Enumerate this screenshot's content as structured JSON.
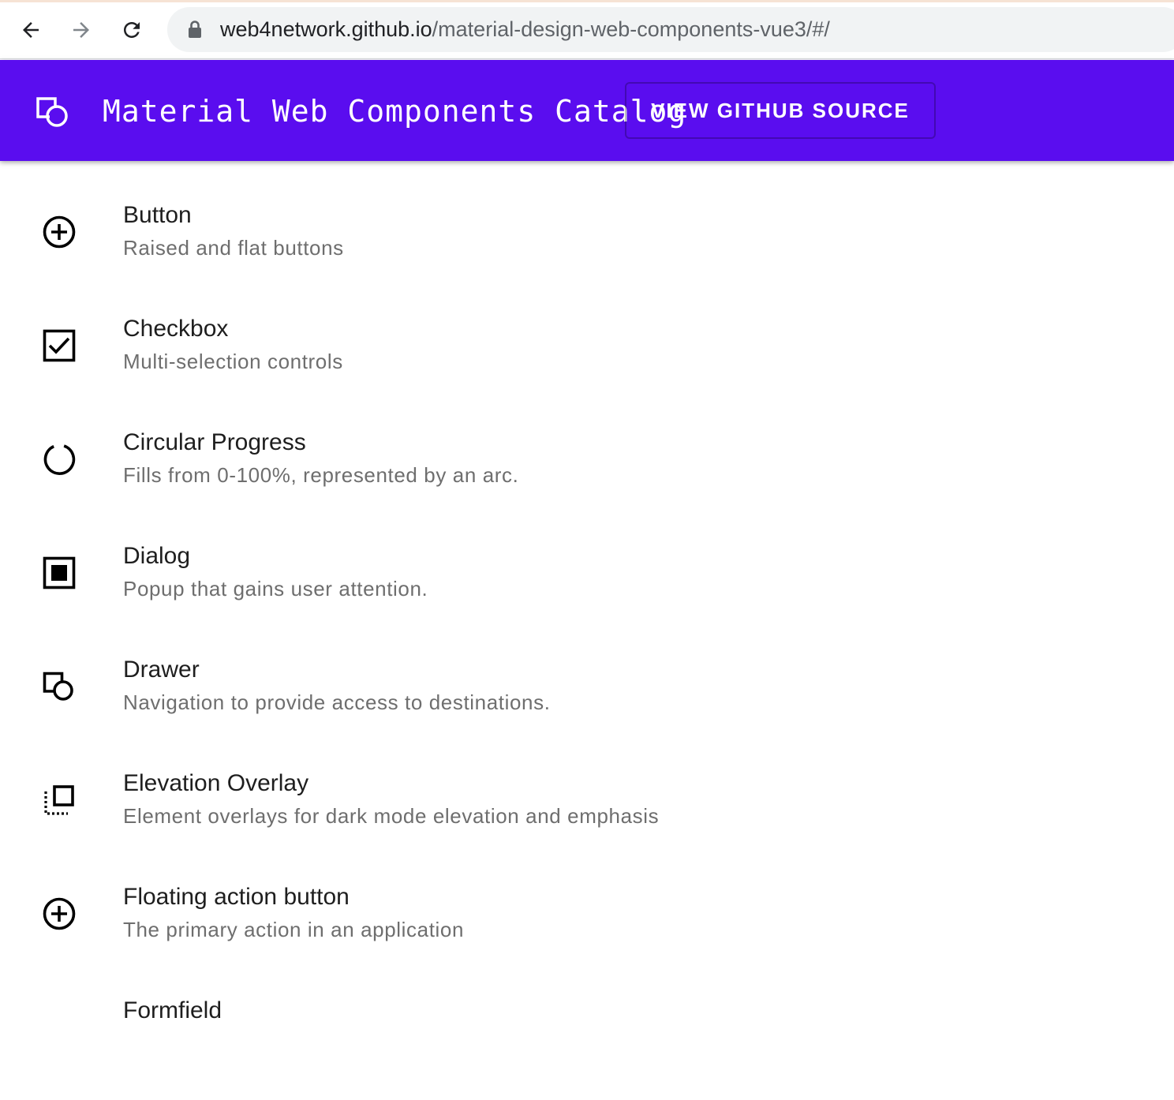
{
  "browser": {
    "url_host": "web4network.github.io",
    "url_path": "/material-design-web-components-vue3/#/",
    "back_icon": "arrow-left-icon",
    "forward_icon": "arrow-right-icon",
    "reload_icon": "reload-icon",
    "lock_icon": "lock-icon"
  },
  "appbar": {
    "title": "Material Web Components Catalog",
    "github_button": "VIEW GITHUB SOURCE",
    "logo_icon": "square-circle-logo-icon",
    "background": "#5a0def"
  },
  "components": [
    {
      "label": "Button",
      "description": "Raised and flat buttons",
      "icon": "add-circle-icon"
    },
    {
      "label": "Checkbox",
      "description": "Multi-selection controls",
      "icon": "checkbox-icon"
    },
    {
      "label": "Circular Progress",
      "description": "Fills from 0-100%, represented by an arc.",
      "icon": "circular-progress-icon"
    },
    {
      "label": "Dialog",
      "description": "Popup that gains user attention.",
      "icon": "dialog-icon"
    },
    {
      "label": "Drawer",
      "description": "Navigation to provide access to destinations.",
      "icon": "drawer-icon"
    },
    {
      "label": "Elevation Overlay",
      "description": "Element overlays for dark mode elevation and emphasis",
      "icon": "elevation-overlay-icon"
    },
    {
      "label": "Floating action button",
      "description": "The primary action in an application",
      "icon": "fab-add-circle-icon"
    },
    {
      "label": "Formfield",
      "description": "",
      "icon": ""
    }
  ]
}
